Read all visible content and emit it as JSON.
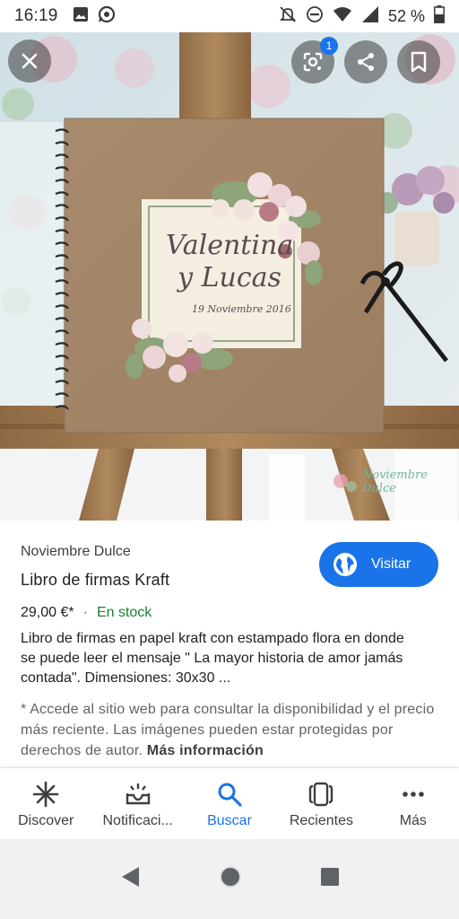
{
  "status_bar": {
    "time": "16:19",
    "battery_text": "52 %",
    "icons": [
      "image-icon",
      "whatsapp-icon",
      "mute-icon",
      "dnd-icon",
      "wifi-icon",
      "signal-icon",
      "battery-icon"
    ]
  },
  "hero": {
    "cover_names": "Valentina\ny Lucas",
    "cover_date": "19 Noviembre 2016",
    "watermark": "Noviembre Dulce",
    "lens_badge": "1",
    "buttons": [
      "close-icon",
      "google-lens-icon",
      "share-icon",
      "bookmark-icon"
    ]
  },
  "product": {
    "source": "Noviembre Dulce",
    "title": "Libro de firmas Kraft",
    "price": "29,00 €*",
    "separator": "·",
    "stock": "En stock",
    "description": "Libro de firmas en papel kraft con estampado flora en donde se puede leer el mensaje \" La mayor historia de amor jamás contada\". Dimensiones: 30x30 ...",
    "note": "* Accede al sitio web para consultar la disponibilidad y el precio más reciente. Las imágenes pueden estar protegidas por derechos de autor.",
    "more_info": "Más información",
    "visit_label": "Visitar"
  },
  "bottom_nav": {
    "items": [
      {
        "label": "Discover",
        "icon": "asterisk-icon"
      },
      {
        "label": "Notificaci...",
        "icon": "inbox-notification-icon"
      },
      {
        "label": "Buscar",
        "icon": "search-icon"
      },
      {
        "label": "Recientes",
        "icon": "recent-tabs-icon"
      },
      {
        "label": "Más",
        "icon": "more-horizontal-icon"
      }
    ],
    "active_index": 2
  },
  "system_nav": [
    "back-icon",
    "home-icon",
    "overview-icon"
  ],
  "colors": {
    "accent": "#1a73e8",
    "stock_green": "#188038",
    "kraft": "#a98a6c"
  }
}
